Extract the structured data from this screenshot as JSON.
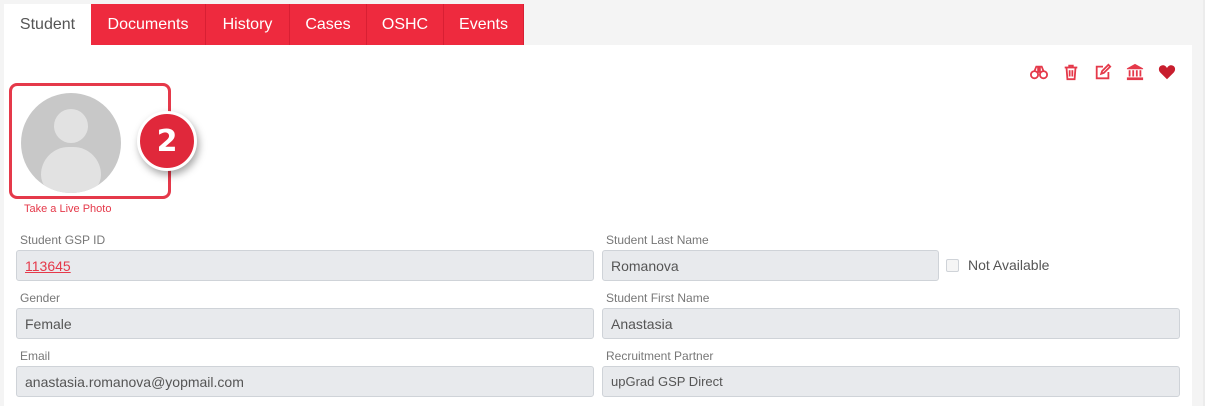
{
  "tabs": [
    {
      "label": "Student"
    },
    {
      "label": "Documents"
    },
    {
      "label": "History"
    },
    {
      "label": "Cases"
    },
    {
      "label": "OSHC"
    },
    {
      "label": "Events"
    }
  ],
  "actions": [
    "binoculars-icon",
    "trash-icon",
    "edit-icon",
    "institution-icon",
    "heart-icon"
  ],
  "colors": {
    "accent": "#ee2a3e",
    "field_bg": "#e8eaed"
  },
  "step_badge": "2",
  "live_photo_label": "Take a Live Photo",
  "form": {
    "gsp_id": {
      "label": "Student GSP ID",
      "value": "113645"
    },
    "last_name": {
      "label": "Student Last Name",
      "value": "Romanova"
    },
    "not_available": {
      "label": "Not Available",
      "checked": false
    },
    "gender": {
      "label": "Gender",
      "value": "Female"
    },
    "first_name": {
      "label": "Student First Name",
      "value": "Anastasia"
    },
    "email": {
      "label": "Email",
      "value": "anastasia.romanova@yopmail.com"
    },
    "recruitment_partner": {
      "label": "Recruitment Partner",
      "value": "upGrad GSP Direct"
    }
  }
}
